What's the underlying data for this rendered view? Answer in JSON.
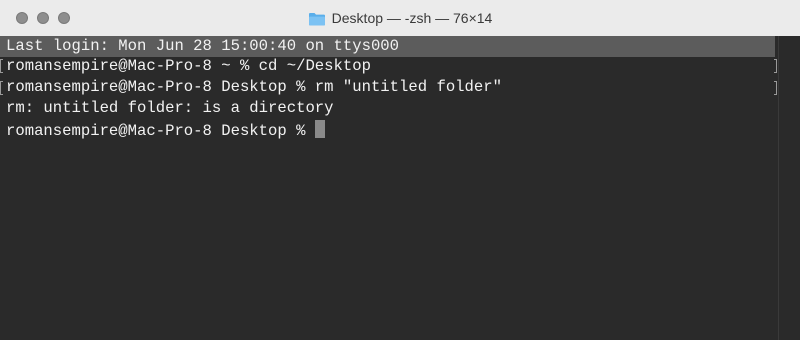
{
  "window": {
    "title": "Desktop — -zsh — 76×14",
    "folder_icon": "folder-icon",
    "traffic_lights": [
      "close",
      "minimize",
      "zoom"
    ]
  },
  "terminal": {
    "lines": [
      "Last login: Mon Jun 28 15:00:40 on ttys000",
      "romansempire@Mac-Pro-8 ~ % cd ~/Desktop",
      "romansempire@Mac-Pro-8 Desktop % rm \"untitled folder\"",
      "rm: untitled folder: is a directory",
      "romansempire@Mac-Pro-8 Desktop % "
    ]
  },
  "colors": {
    "titlebar": "#ebebeb",
    "terminal_bg": "#2a2a2a",
    "text": "#f2f2f2",
    "login_highlight": "#5c5c5c",
    "cursor": "#8a8a8a"
  }
}
